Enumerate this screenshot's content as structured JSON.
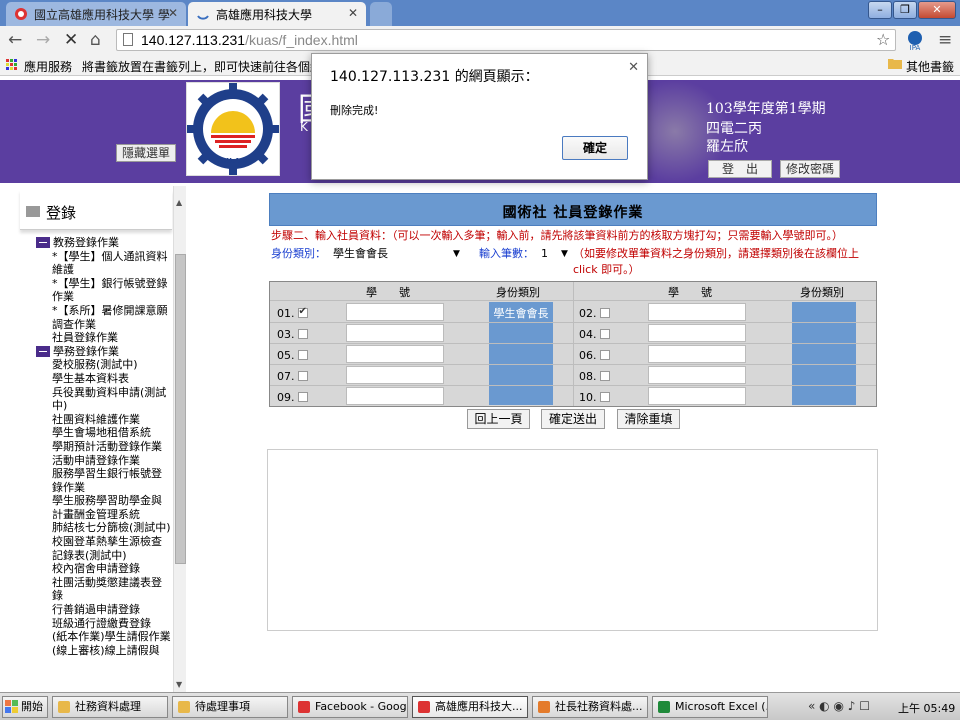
{
  "browser": {
    "tabs": [
      {
        "label": "國立高雄應用科技大學 學",
        "active": false
      },
      {
        "label": "高雄應用科技大學",
        "active": true
      }
    ],
    "url_host": "140.127.113.231",
    "url_path": "/kuas/f_index.html",
    "bookmarks": {
      "apps_label": "應用服務",
      "hint": "將書籤放置在書籤列上，即可快速前往各個網頁",
      "other_label": "其他書籤"
    }
  },
  "header": {
    "hide_menu_label": "隱藏選單",
    "logo_text": "K.U.A.S",
    "title_char": "國",
    "subtitle_char": "K",
    "semester": "103學年度第1學期",
    "class_name": "四電二丙",
    "user_name": "羅左欣",
    "logout_label": "登　出",
    "change_password_label": "修改密碼"
  },
  "sidebar": {
    "title": "登錄",
    "tree": [
      {
        "type": "cat",
        "text": "教務登錄作業"
      },
      {
        "type": "leaf",
        "text": "*【學生】個人通訊資料維護"
      },
      {
        "type": "leaf",
        "text": "*【學生】銀行帳號登錄作業"
      },
      {
        "type": "leaf",
        "text": "*【系所】暑修開課意願調查作業"
      },
      {
        "type": "leaf",
        "text": "社員登錄作業"
      },
      {
        "type": "cat",
        "text": "學務登錄作業"
      },
      {
        "type": "leaf",
        "text": "愛校服務(測試中)"
      },
      {
        "type": "leaf",
        "text": "學生基本資料表"
      },
      {
        "type": "leaf",
        "text": "兵役異動資料申請(測試中)"
      },
      {
        "type": "leaf",
        "text": "社團資料維護作業"
      },
      {
        "type": "leaf",
        "text": "學生會場地租借系統"
      },
      {
        "type": "leaf",
        "text": "學期預計活動登錄作業"
      },
      {
        "type": "leaf",
        "text": "活動申請登錄作業"
      },
      {
        "type": "leaf",
        "text": "服務學習生銀行帳號登錄作業"
      },
      {
        "type": "leaf",
        "text": "學生服務學習助學金與計畫酬金管理系統"
      },
      {
        "type": "leaf",
        "text": "肺結核七分篩檢(測試中)"
      },
      {
        "type": "leaf",
        "text": "校園登革熱孳生源檢查記錄表(測試中)"
      },
      {
        "type": "leaf",
        "text": "校內宿舍申請登錄"
      },
      {
        "type": "leaf",
        "text": "社團活動獎懲建議表登錄"
      },
      {
        "type": "leaf",
        "text": "行善銷過申請登錄"
      },
      {
        "type": "leaf",
        "text": "班級通行證繳費登錄"
      },
      {
        "type": "leaf",
        "text": "(紙本作業)學生請假作業"
      },
      {
        "type": "leaf",
        "text": "(線上審核)線上請假與"
      }
    ]
  },
  "form": {
    "title": "國術社 社員登錄作業",
    "instructions": "步驟二、輸入社員資料：（可以一次輸入多筆；輸入前，請先將該筆資料前方的核取方塊打勾；只需要輸入學號即可。）",
    "role_label": "身份類別：",
    "role_value": "學生會會長",
    "count_label": "輸入筆數：",
    "count_value": "1",
    "note": "（如要修改單筆資料之身份類別，請選擇類別後在該欄位上 click 即可。）",
    "col_id": "學　　號",
    "col_role": "身份類別",
    "rows": [
      {
        "num": "01.",
        "checked": true,
        "role": "學生會會長"
      },
      {
        "num": "02.",
        "checked": false,
        "role": ""
      },
      {
        "num": "03.",
        "checked": false,
        "role": ""
      },
      {
        "num": "04.",
        "checked": false,
        "role": ""
      },
      {
        "num": "05.",
        "checked": false,
        "role": ""
      },
      {
        "num": "06.",
        "checked": false,
        "role": ""
      },
      {
        "num": "07.",
        "checked": false,
        "role": ""
      },
      {
        "num": "08.",
        "checked": false,
        "role": ""
      },
      {
        "num": "09.",
        "checked": false,
        "role": ""
      },
      {
        "num": "10.",
        "checked": false,
        "role": ""
      }
    ],
    "buttons": {
      "back": "回上一頁",
      "submit": "確定送出",
      "reset": "清除重填"
    }
  },
  "dialog": {
    "title": "140.127.113.231 的網頁顯示：",
    "message": "刪除完成!",
    "ok_label": "確定"
  },
  "taskbar": {
    "start_label": "開始",
    "items": [
      "社務資料處理",
      "待處理事項",
      "Facebook - Googl...",
      "高雄應用科技大...",
      "社長社務資料處...",
      "Microsoft Excel (..."
    ],
    "clock": "上午 05:49"
  },
  "colors": {
    "header_purple": "#5b3ea0",
    "banner_blue": "#6a99d0",
    "instruction_red": "#c00000",
    "label_blue": "#1a3fd0"
  }
}
